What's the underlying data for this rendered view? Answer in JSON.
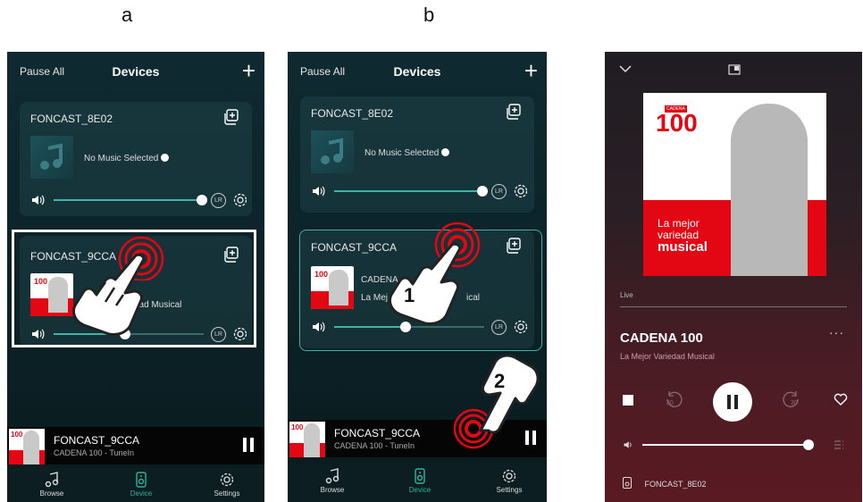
{
  "labels": {
    "a": "a",
    "b": "b"
  },
  "annotations": {
    "step1": "1",
    "step2": "2"
  },
  "app": {
    "pause_all": "Pause All",
    "title": "Devices",
    "add": "+",
    "devices": [
      {
        "name": "FONCAST_8E02",
        "status": "No Music Selected",
        "volume": 0.95,
        "lr": "LR"
      },
      {
        "name": "FONCAST_9CCA",
        "station": "CADENA",
        "desc": "La Mejor Variedad Musical",
        "desc_a": "dad Musical",
        "desc_b_left": "La Mej",
        "desc_b_right": "ical",
        "volume": 0.47,
        "lr": "LR"
      }
    ],
    "now_playing": {
      "device": "FONCAST_9CCA",
      "source": "CADENA 100 - TuneIn"
    },
    "tabs": [
      {
        "label": "Browse",
        "icon": "music-note-icon"
      },
      {
        "label": "Device",
        "icon": "speaker-icon",
        "active": true
      },
      {
        "label": "Settings",
        "icon": "gear-icon"
      }
    ]
  },
  "player": {
    "live": "Live",
    "station": "CADENA 100",
    "subtitle": "La Mejor Variedad Musical",
    "more": "···",
    "skip_back": "30",
    "skip_fwd": "30",
    "volume": 0.85,
    "device": "FONCAST_8E02"
  },
  "art": {
    "logo": "100",
    "line1": "La mejor",
    "line2": "variedad",
    "line3": "musical",
    "badge": "CADENA"
  },
  "colors": {
    "accent": "#3fb3a6",
    "red": "#e30613"
  }
}
